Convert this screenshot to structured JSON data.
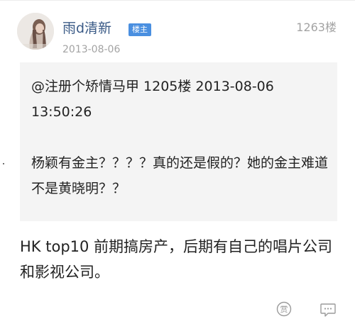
{
  "post": {
    "author": "雨d清新",
    "badge": "楼主",
    "date": "2013-08-06",
    "floor": "1263楼",
    "quote": {
      "header": "@注册个矫情马甲 1205楼 2013-08-06 13:50:26",
      "body": "杨颖有金主？？？？真的还是假的？她的金主难道不是黄晓明？？"
    },
    "reply": "HK top10 前期搞房产，后期有自己的唱片公司和影视公司。",
    "actions": {
      "reward_glyph": "赏"
    }
  },
  "colors": {
    "author_name": "#3a5a86",
    "badge_bg": "#4a8fe0",
    "meta_gray": "#a3a3a3",
    "quote_bg": "#f4f4f4"
  },
  "icons": [
    "avatar-photo",
    "reward-icon",
    "comment-icon"
  ]
}
